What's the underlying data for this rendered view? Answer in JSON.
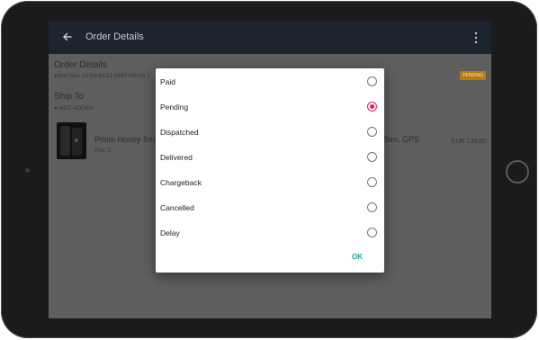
{
  "appbar": {
    "title": "Order Details",
    "back_icon": "arrow-left-icon",
    "menu_icon": "more-vertical-icon"
  },
  "order": {
    "section_title": "Order Details",
    "meta": "●Sun Nov 13 03:43:21 GMT+08:00 2",
    "status_badge": "PENDING"
  },
  "ship_to": {
    "title": "Ship To",
    "value": "● NOT ADDED"
  },
  "product": {
    "name_left": "Prism Honey Sm",
    "name_right": "l Sim, GPS",
    "pcs": "Pcs: 2",
    "price": "EUR 139.00"
  },
  "dialog": {
    "options": [
      {
        "label": "Paid",
        "checked": false
      },
      {
        "label": "Pending",
        "checked": true
      },
      {
        "label": "Dispatched",
        "checked": false
      },
      {
        "label": "Delivered",
        "checked": false
      },
      {
        "label": "Chargeback",
        "checked": false
      },
      {
        "label": "Cancelled",
        "checked": false
      },
      {
        "label": "Delay",
        "checked": false
      }
    ],
    "ok_label": "OK"
  },
  "colors": {
    "accent_radio": "#e91e63",
    "ok_button": "#16a39a",
    "appbar_bg": "#1c2430",
    "pending_badge": "#b37b12"
  }
}
